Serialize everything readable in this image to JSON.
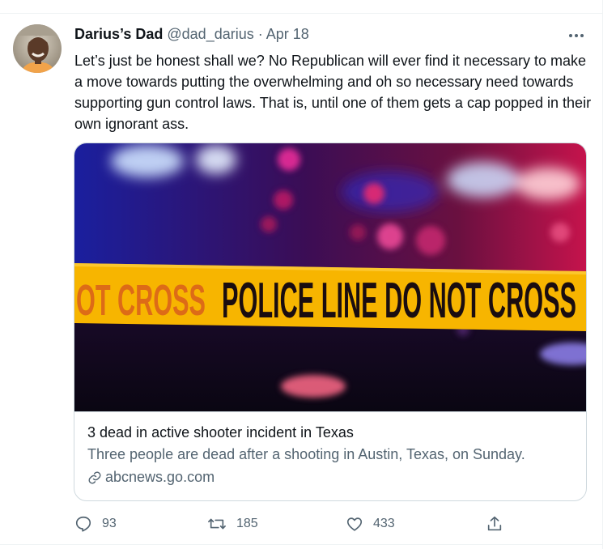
{
  "tweet": {
    "author_name": "Darius’s Dad",
    "handle": "@dad_darius",
    "separator": "·",
    "date": "Apr 18",
    "text": "Let’s just be honest shall we? No Republican will ever find it necessary to make a move towards putting the overwhelming and oh so necessary need towards supporting gun control laws. That is, until one of them gets a cap popped in their own ignorant ass."
  },
  "card": {
    "tape_text": "POLICE LINE DO NOT CROSS",
    "tape_text_partial": "OT CROSS",
    "title": "3 dead in active shooter incident in Texas",
    "description": "Three people are dead after a shooting in Austin, Texas, on Sunday.",
    "domain": "abcnews.go.com"
  },
  "actions": {
    "replies": "93",
    "retweets": "185",
    "likes": "433"
  },
  "icons": {
    "more": "more-icon",
    "reply": "reply-icon",
    "retweet": "retweet-icon",
    "like": "like-icon",
    "share": "share-icon",
    "link": "link-icon"
  },
  "colors": {
    "text_primary": "#0f1419",
    "text_secondary": "#536471",
    "border": "#cfd9de",
    "tape_yellow": "#f7b500"
  }
}
